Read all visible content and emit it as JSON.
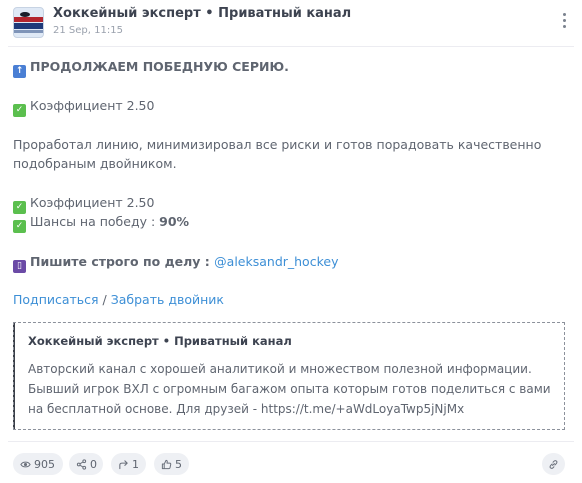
{
  "header": {
    "channel_name": "Хоккейный эксперт • Приватный канал",
    "date": "21 Sep, 11:15",
    "avatar_icon": "hockey-logo",
    "more_icon": "more-vertical-icon"
  },
  "post": {
    "headline": "ПРОДОЛЖАЕМ ПОБЕДНУЮ СЕРИЮ.",
    "coef1": "Коэффициент 2.50",
    "paragraph_line1": "Проработал линию, минимизировал все риски и готов порадовать качественно",
    "paragraph_line2": "подобраным двойником.",
    "coef2": "Коэффициент 2.50",
    "chance_label": "Шансы на победу : ",
    "chance_value": "90%",
    "contact_label": "Пишите строго по делу : ",
    "contact_handle": "@aleksandr_hockey",
    "link_subscribe": "Подписаться",
    "link_separator": " / ",
    "link_take": "Забрать двойник"
  },
  "quote": {
    "title": "Хоккейный эксперт • Приватный канал",
    "text": "Авторский канал с хорошей аналитикой и множеством полезной информации. Бывший игрок ВХЛ с огромным багажом опыта которым готов поделиться с вами на бесплатной основе. Для друзей - https://t.me/+aWdLoyaTwp5jNjMx"
  },
  "footer": {
    "views": "905",
    "shares": "0",
    "replies": "1",
    "likes": "5"
  },
  "colors": {
    "link": "#3d8fd6",
    "check": "#5bbf4e",
    "pill_bg": "#eef0f4"
  }
}
